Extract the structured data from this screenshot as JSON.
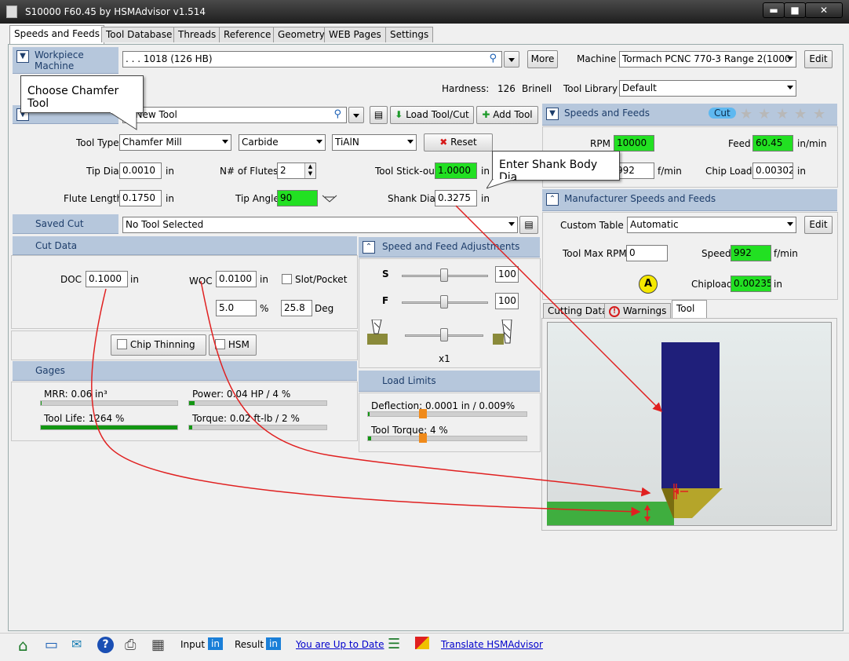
{
  "window": {
    "title": "S10000 F60.45 by HSMAdvisor v1.514",
    "controls": {
      "minimize": "▬",
      "maximize": "■",
      "close": "✕"
    }
  },
  "tabs": [
    "Speeds and Feeds",
    "Tool Database",
    "Threads",
    "Reference",
    "Geometry",
    "WEB Pages",
    "Settings"
  ],
  "workpiece": {
    "header": "Workpiece Machine",
    "header_line1": "Workpiece",
    "header_line2": "Machine",
    "material": ". . . 1018 (126 HB)",
    "more_label": "More",
    "machine_label": "Machine",
    "machine_value": "Tormach PCNC 770-3 Range 2(1000",
    "edit_label": "Edit",
    "hardness_label": "Hardness:",
    "hardness_value": "126",
    "hardness_unit": "Brinell",
    "tool_library_label": "Tool Library",
    "tool_library_value": "Default"
  },
  "tool": {
    "name": "ll New Tool",
    "load_label": "Load Tool/Cut",
    "add_label": "Add Tool",
    "tool_type_label": "Tool Type",
    "tool_type_value": "Chamfer Mill",
    "material_value": "Carbide",
    "coating_value": "TiAlN",
    "reset_label": "Reset",
    "tip_dia_label": "Tip Dia",
    "tip_dia_value": "0.0010",
    "tip_dia_unit": "in",
    "flutes_label": "N# of Flutes",
    "flutes_value": "2",
    "stickout_label": "Tool Stick-out",
    "stickout_value": "1.0000",
    "stickout_unit": "in",
    "flute_len_label": "Flute Length",
    "flute_len_value": "0.1750",
    "flute_len_unit": "in",
    "tip_angle_label": "Tip Angle",
    "tip_angle_value": "90",
    "shank_label": "Shank Dia",
    "shank_value": "0.3275",
    "shank_unit": "in"
  },
  "saved_cut": {
    "label": "Saved Cut",
    "value": "No Tool Selected"
  },
  "cut_data": {
    "header": "Cut Data",
    "doc_label": "DOC",
    "doc_value": "0.1000",
    "doc_unit": "in",
    "woc_label": "WOC",
    "woc_value": "0.0100",
    "woc_unit": "in",
    "slot_label": "Slot/Pocket",
    "woc_pct_value": "5.0",
    "woc_pct_unit": "%",
    "angle_value": "25.8",
    "angle_unit": "Deg"
  },
  "adjust": {
    "header": "Speed and Feed Adjustments",
    "s_label": "S",
    "s_value": "100",
    "f_label": "F",
    "f_value": "100",
    "x_label": "x1"
  },
  "options": {
    "chip_thinning": "Chip Thinning",
    "hsm": "HSM"
  },
  "gages": {
    "header": "Gages",
    "mrr": "MRR: 0.06 in³",
    "power": "Power: 0.04 HP / 4 %",
    "power_pct": 4,
    "tool_life": "Tool Life: 1264 %",
    "tool_life_fill": 1.0,
    "torque": "Torque: 0.02 ft-lb / 2 %",
    "torque_pct": 2
  },
  "load_limits": {
    "header": "Load Limits",
    "deflection": "Deflection: 0.0001 in / 0.009%",
    "torque": "Tool Torque: 4 %"
  },
  "speeds_feeds": {
    "header": "Speeds and Feeds",
    "cut_badge": "Cut",
    "rpm_label": "RPM",
    "rpm_value": "10000",
    "feed_label": "Feed",
    "feed_value": "60.45",
    "feed_unit": "in/min",
    "sfm_value": "992",
    "sfm_unit": "f/min",
    "chipload_label": "Chip Load",
    "chipload_value": "0.00302",
    "chipload_unit": "in"
  },
  "manufacturer": {
    "header": "Manufacturer Speeds and Feeds",
    "table_label": "Custom Table",
    "table_value": "Automatic",
    "edit_label": "Edit",
    "max_rpm_label": "Tool Max RPM",
    "max_rpm_value": "0",
    "speed_label": "Speed",
    "speed_value": "992",
    "speed_unit": "f/min",
    "a_badge": "A",
    "chipload_label": "Chipload",
    "chipload_value": "0.00235",
    "chipload_unit": "in"
  },
  "bottom_tabs": [
    "Cutting Data",
    "Warnings",
    "Tool"
  ],
  "callouts": {
    "chamfer": "Choose Chamfer Tool",
    "shank": "Enter Shank Body Dia"
  },
  "status": {
    "input_label": "Input",
    "input_unit": "in",
    "result_label": "Result",
    "result_unit": "in",
    "update_link": "You are Up to Date",
    "translate_link": "Translate HSMAdvisor"
  },
  "colors": {
    "accent_green": "#22e022",
    "header_blue": "#b6c7dc",
    "tool_shank": "#20207a",
    "stock_green": "#3fae3f",
    "arrow_red": "#e02020"
  }
}
